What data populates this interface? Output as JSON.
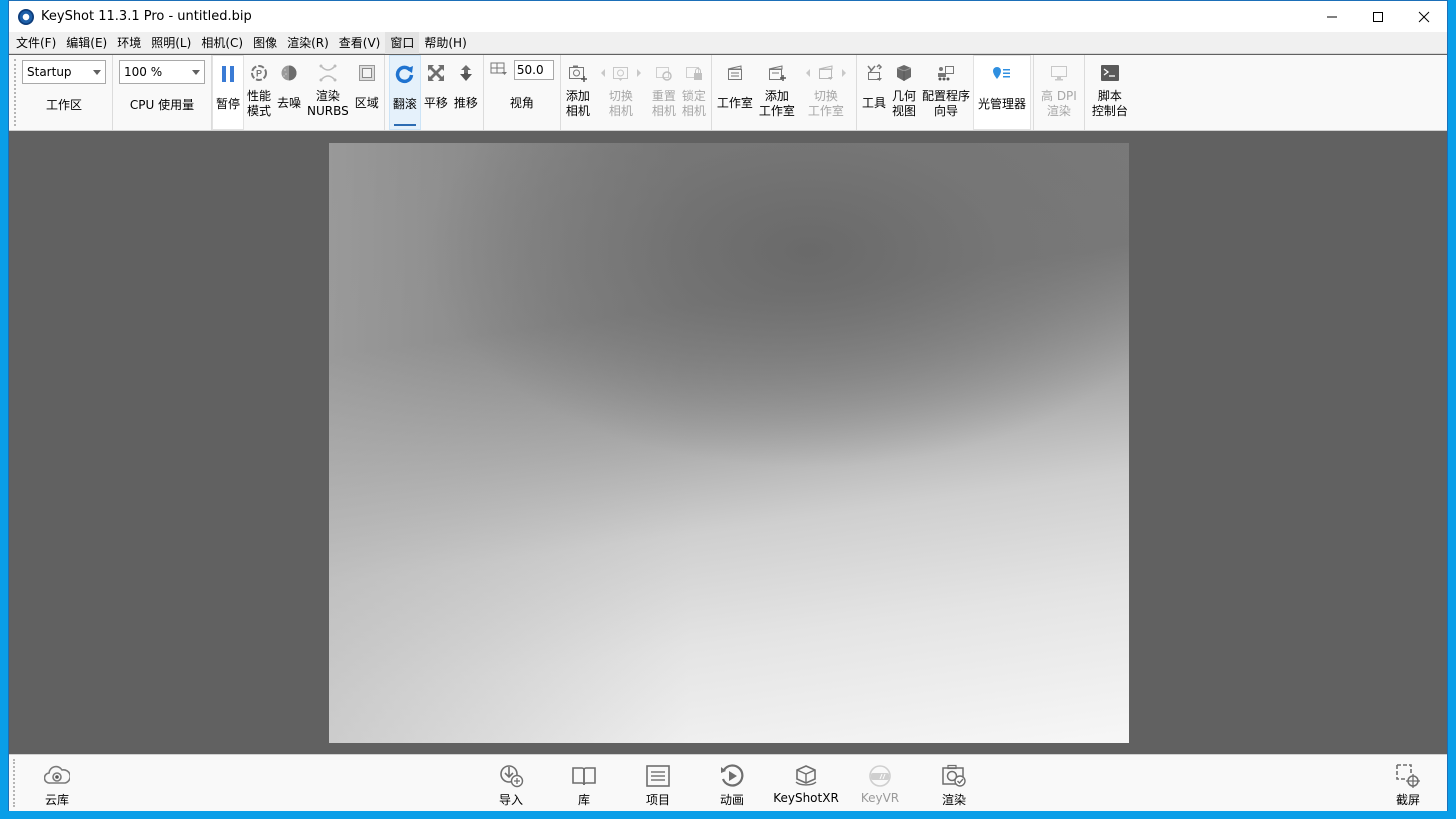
{
  "window": {
    "title": "KeyShot 11.3.1 Pro  - untitled.bip",
    "controls": {
      "minimize": "minimize",
      "maximize": "maximize",
      "close": "close"
    }
  },
  "menu": [
    {
      "label": "文件(F)"
    },
    {
      "label": "编辑(E)"
    },
    {
      "label": "环境"
    },
    {
      "label": "照明(L)"
    },
    {
      "label": "相机(C)"
    },
    {
      "label": "图像"
    },
    {
      "label": "渲染(R)"
    },
    {
      "label": "查看(V)"
    },
    {
      "label": "窗口",
      "active": true
    },
    {
      "label": "帮助(H)"
    }
  ],
  "ribbon": {
    "workspace": {
      "value": "Startup",
      "label": "工作区"
    },
    "cpu": {
      "value": "100 %",
      "label": "CPU 使用量"
    },
    "pause": {
      "label": "暂停"
    },
    "perf_mode": {
      "label": "性能\n模式"
    },
    "denoise": {
      "label": "去噪"
    },
    "nurbs": {
      "label": "渲染\nNURBS"
    },
    "region": {
      "label": "区域"
    },
    "tumble": {
      "label": "翻滚",
      "selected": true
    },
    "pan": {
      "label": "平移"
    },
    "dolly": {
      "label": "推移"
    },
    "fov": {
      "value": "50.0",
      "label": "视角"
    },
    "add_camera": {
      "label": "添加\n相机"
    },
    "switch_camera": {
      "label": "切换\n相机",
      "disabled": true
    },
    "reset_camera": {
      "label": "重置\n相机",
      "disabled": true
    },
    "lock_camera": {
      "label": "锁定\n相机",
      "disabled": true
    },
    "studio": {
      "label": "工作室"
    },
    "add_studio": {
      "label": "添加\n工作室"
    },
    "switch_studio": {
      "label": "切换\n工作室",
      "disabled": true
    },
    "tools": {
      "label": "工具"
    },
    "geometry_view": {
      "label": "几何\n视图"
    },
    "configurator_wizard": {
      "label": "配置程序\n向导"
    },
    "light_manager": {
      "label": "光管理器"
    },
    "high_dpi": {
      "label": "高 DPI\n渲染",
      "disabled": true
    },
    "script_console": {
      "label": "脚本\n控制台"
    }
  },
  "bottombar": {
    "cloud_library": {
      "label": "云库"
    },
    "import": {
      "label": "导入"
    },
    "library": {
      "label": "库"
    },
    "project": {
      "label": "项目"
    },
    "animation": {
      "label": "动画"
    },
    "keyshotxr": {
      "label": "KeyShotXR"
    },
    "keyvr": {
      "label": "KeyVR",
      "disabled": true
    },
    "render": {
      "label": "渲染"
    },
    "screenshot": {
      "label": "截屏"
    }
  },
  "colors": {
    "accent": "#2b6cb3",
    "viewport_bg": "#616161",
    "light_manager_icon": "#2f8fe0"
  }
}
